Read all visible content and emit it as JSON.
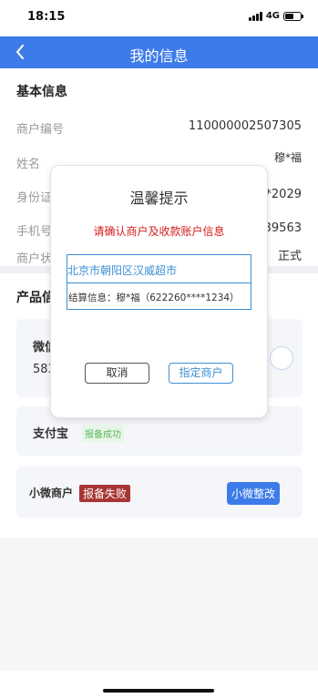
{
  "status_bar": {
    "time": "18:15",
    "network": "4G"
  },
  "nav": {
    "title": "我的信息"
  },
  "basic": {
    "title": "基本信息",
    "merchant_no_label": "商户编号",
    "merchant_no_value": "110000002507305",
    "name_label": "姓名",
    "name_value": "穆*福",
    "id_label": "身份证",
    "id_value_fragment": "*2029",
    "phone_label": "手机号",
    "phone_value_fragment": "39563",
    "status_label": "商户状",
    "status_value": "正式"
  },
  "products": {
    "title_fragment": "产品信",
    "wechat_label_fragment": "微信",
    "wechat_number_fragment": "583",
    "alipay_label": "支付宝",
    "alipay_badge": "报备成功",
    "micro_label": "小微商户",
    "micro_badge": "报备失败",
    "micro_button": "小微整改"
  },
  "modal": {
    "title": "温馨提示",
    "subtitle": "请确认商户及收款账户信息",
    "address": "北京市朝阳区汉威超市",
    "settlement": "结算信息：穆*福（622260****1234）",
    "cancel_label": "取消",
    "confirm_label": "指定商户"
  },
  "colors": {
    "brand_blue": "#3d7be9",
    "warning_red": "#d51d1d",
    "failed_badge": "#a83434",
    "success_green": "#5cb85c"
  }
}
